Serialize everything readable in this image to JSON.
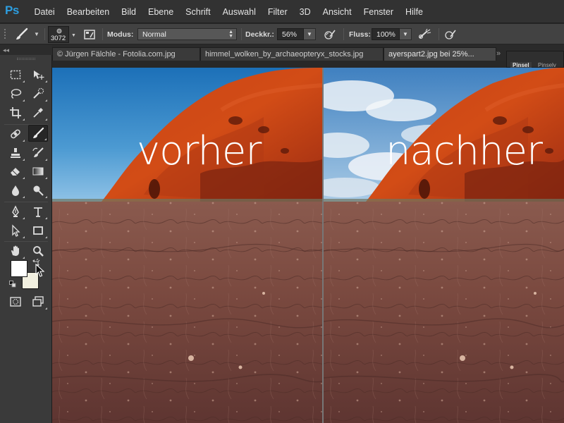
{
  "app": {
    "logo": "Ps"
  },
  "menu": [
    "Datei",
    "Bearbeiten",
    "Bild",
    "Ebene",
    "Schrift",
    "Auswahl",
    "Filter",
    "3D",
    "Ansicht",
    "Fenster",
    "Hilfe"
  ],
  "options": {
    "brush_size": "3072",
    "mode_label": "Modus:",
    "mode_value": "Normal",
    "opacity_label": "Deckkr.:",
    "opacity_value": "56%",
    "flow_label": "Fluss:",
    "flow_value": "100%"
  },
  "tabs": [
    {
      "label": "© Jürgen Fälchle - Fotolia.com.jpg"
    },
    {
      "label": "himmel_wolken_by_archaeopteryx_stocks.jpg"
    },
    {
      "label": "ayerspart2.jpg bei 25%..."
    }
  ],
  "panel_tabs": {
    "first": "Pinsel",
    "second": "Pinselv"
  },
  "toolbar": {
    "collapse_glyph": "◂◂",
    "foreground_color": "#ffffff",
    "background_color": "#f1efdf"
  },
  "canvas": {
    "caption_before": "vorher",
    "caption_after": "nachher"
  }
}
